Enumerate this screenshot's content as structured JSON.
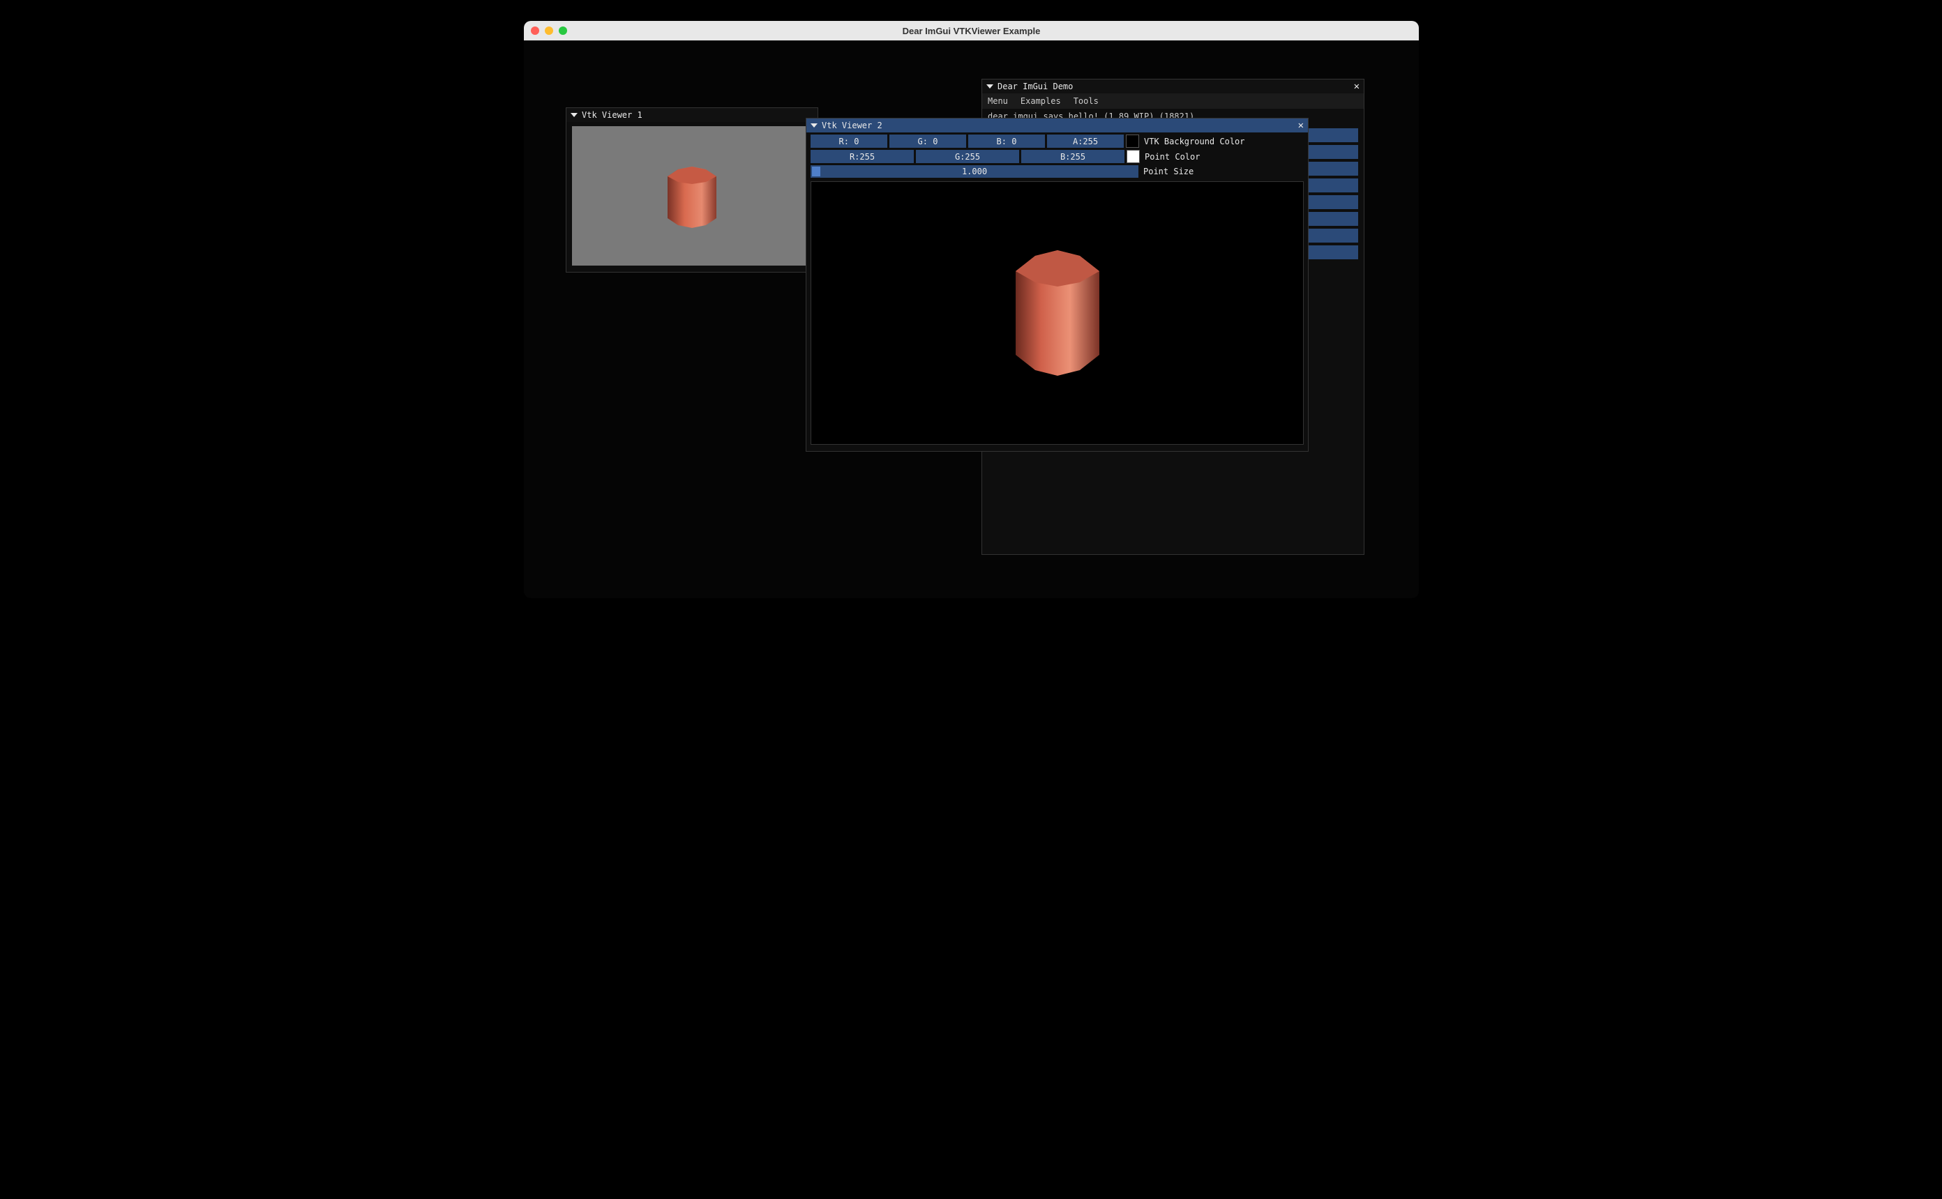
{
  "window": {
    "title": "Dear ImGui VTKViewer Example"
  },
  "demo": {
    "title": "Dear ImGui Demo",
    "menu": {
      "menu": "Menu",
      "examples": "Examples",
      "tools": "Tools"
    },
    "hello_line": "dear imgui says hello! (1.89 WIP) (18821)"
  },
  "viewer1": {
    "title": "Vtk Viewer 1"
  },
  "viewer2": {
    "title": "Vtk Viewer 2",
    "bg_color": {
      "r": "R:  0",
      "g": "G:  0",
      "b": "B:  0",
      "a": "A:255",
      "label": "VTK Background Color",
      "swatch": "#000000"
    },
    "point_color": {
      "r": "R:255",
      "g": "G:255",
      "b": "B:255",
      "label": "Point Color",
      "swatch": "#ffffff"
    },
    "point_size": {
      "value": "1.000",
      "label": "Point Size"
    }
  },
  "close_glyph": "✕"
}
